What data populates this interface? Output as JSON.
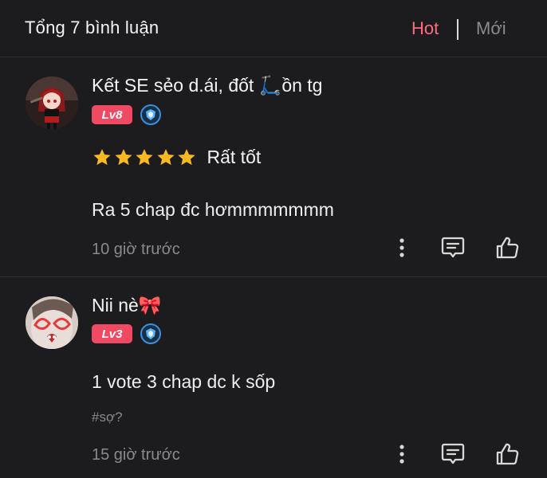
{
  "header": {
    "title": "Tổng 7 bình luận",
    "tabs": [
      {
        "label": "Hot",
        "active": true
      },
      {
        "label": "Mới",
        "active": false
      }
    ],
    "accent_color": "#ff6b81"
  },
  "comments": [
    {
      "username": "Kết SE sẻo d.ái, đốt 🛴ồn tg",
      "level_badge": "Lv8",
      "rank_icon": "blue-shield-icon",
      "rating": {
        "stars": 5,
        "max_stars": 5,
        "label": "Rất tốt"
      },
      "text": "Ra 5 chap đc hơmmmmmmm",
      "hashtag": "",
      "time": "10 giờ trước"
    },
    {
      "username": "Nii nè🎀",
      "level_badge": "Lv3",
      "rank_icon": "blue-shield-icon",
      "text": "1 vote 3 chap dc k sốp",
      "hashtag": "#sợ?",
      "time": "15 giờ trước"
    }
  ]
}
